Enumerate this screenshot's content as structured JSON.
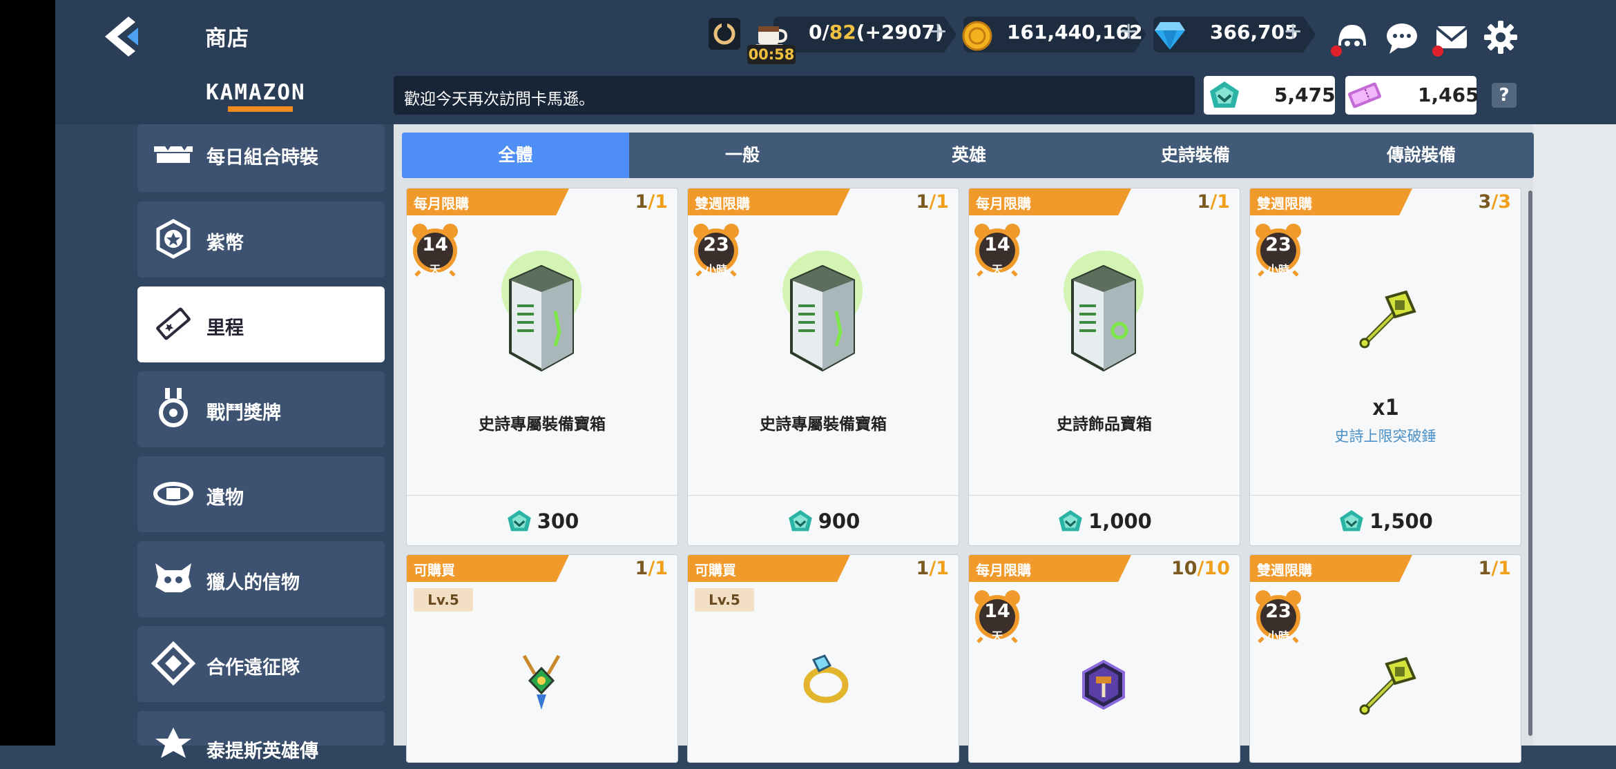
{
  "header": {
    "title": "商店",
    "stamina": {
      "current": "0",
      "max": "82",
      "bonus": "(+2907)"
    },
    "timer": "00:58",
    "gold": "161,440,162",
    "gems": "366,705"
  },
  "subheader": {
    "brand": "KAMAZON",
    "welcome": "歡迎今天再次訪問卡馬遜。",
    "mileage_balance": "5,475",
    "ticket_balance": "1,465",
    "help": "?"
  },
  "sidebar": {
    "items": [
      {
        "label": "每日組合時裝",
        "icon": "costume-icon"
      },
      {
        "label": "紫幣",
        "icon": "purple-coin-icon"
      },
      {
        "label": "里程",
        "icon": "mileage-ticket-icon",
        "active": true
      },
      {
        "label": "戰鬥獎牌",
        "icon": "medal-icon"
      },
      {
        "label": "遺物",
        "icon": "relic-icon"
      },
      {
        "label": "獵人的信物",
        "icon": "hunter-token-icon"
      },
      {
        "label": "合作遠征隊",
        "icon": "expedition-icon"
      },
      {
        "label": "泰提斯英雄傳",
        "icon": "hero-icon"
      }
    ]
  },
  "tabs": [
    "全體",
    "一般",
    "英雄",
    "史詩裝備",
    "傳說裝備"
  ],
  "products": [
    {
      "banner": "每月限購",
      "limit_cur": "1",
      "limit_max": "1",
      "timer_num": "14",
      "timer_unit": "天",
      "name": "史詩專屬裝備寶箱",
      "price": "300"
    },
    {
      "banner": "雙週限購",
      "limit_cur": "1",
      "limit_max": "1",
      "timer_num": "23",
      "timer_unit": "小時",
      "name": "史詩專屬裝備寶箱",
      "price": "900"
    },
    {
      "banner": "每月限購",
      "limit_cur": "1",
      "limit_max": "1",
      "timer_num": "14",
      "timer_unit": "天",
      "name": "史詩飾品寶箱",
      "price": "1,000"
    },
    {
      "banner": "雙週限購",
      "limit_cur": "3",
      "limit_max": "3",
      "timer_num": "23",
      "timer_unit": "小時",
      "qty": "x1",
      "sub": "史詩上限突破錘",
      "price": "1,500"
    },
    {
      "banner": "可購買",
      "limit_cur": "1",
      "limit_max": "1",
      "level": "Lv.5"
    },
    {
      "banner": "可購買",
      "limit_cur": "1",
      "limit_max": "1",
      "level": "Lv.5"
    },
    {
      "banner": "每月限購",
      "limit_cur": "10",
      "limit_max": "10",
      "timer_num": "14",
      "timer_unit": "天"
    },
    {
      "banner": "雙週限購",
      "limit_cur": "1",
      "limit_max": "1",
      "timer_num": "23",
      "timer_unit": "小時"
    }
  ]
}
